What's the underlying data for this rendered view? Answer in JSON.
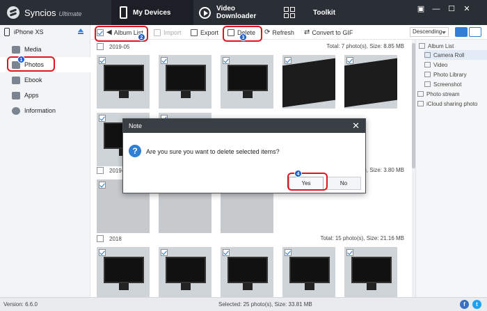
{
  "app": {
    "name": "Syncios",
    "edition": "Ultimate"
  },
  "nav": [
    {
      "label": "My Devices"
    },
    {
      "label": "Video Downloader"
    },
    {
      "label": "Toolkit"
    }
  ],
  "window_controls": [
    "▣",
    "—",
    "☐",
    "✕"
  ],
  "device": {
    "name": "iPhone XS"
  },
  "sidebar": {
    "items": [
      {
        "label": "Media"
      },
      {
        "label": "Photos"
      },
      {
        "label": "Ebook"
      },
      {
        "label": "Apps"
      },
      {
        "label": "Information"
      }
    ]
  },
  "toolbar": {
    "album_list": "Album List",
    "import": "Import",
    "export": "Export",
    "delete": "Delete",
    "refresh": "Refresh",
    "convert": "Convert to GIF",
    "sort": "Descending"
  },
  "groups": [
    {
      "date": "2019-05",
      "total": "Total: 7 photo(s), Size: 8.85 MB"
    },
    {
      "date": "2019-04",
      "total": "Total: 3 photo(s), Size: 3.80 MB"
    },
    {
      "date": "2018",
      "total": "Total: 15 photo(s), Size: 21.16 MB"
    }
  ],
  "right_panel": {
    "items": [
      {
        "label": "Album List"
      },
      {
        "label": "Camera Roll"
      },
      {
        "label": "Video"
      },
      {
        "label": "Photo Library"
      },
      {
        "label": "Screenshot"
      },
      {
        "label": "Photo stream"
      },
      {
        "label": "iCloud sharing photo"
      }
    ]
  },
  "status": {
    "version": "Version: 6.6.0",
    "selected": "Selected: 25 photo(s), Size: 33.81 MB",
    "facebook": "f",
    "twitter": "t"
  },
  "dialog": {
    "title": "Note",
    "close": "✕",
    "icon": "?",
    "message": "Are you sure you want to delete selected items?",
    "yes": "Yes",
    "no": "No"
  },
  "annotations": [
    "1",
    "2",
    "3",
    "4"
  ],
  "colors": {
    "titlebar": "#2a2f36",
    "accent": "#2f7fd6",
    "annotation": "#e0141e"
  }
}
